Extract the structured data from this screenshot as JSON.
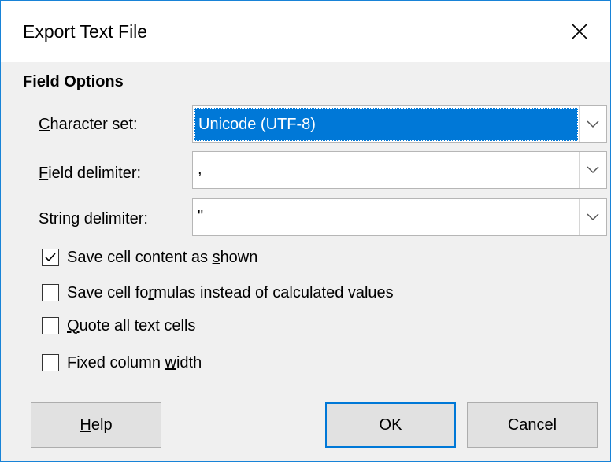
{
  "window": {
    "title": "Export Text File",
    "close_symbol": "✕"
  },
  "field_options": {
    "title": "Field Options",
    "character_set": {
      "label_accel": "C",
      "label_rest": "haracter set:",
      "value": "Unicode (UTF-8)"
    },
    "field_delimiter": {
      "label_accel": "F",
      "label_rest": "ield delimiter:",
      "value": ","
    },
    "string_delimiter": {
      "label": "String delimiter:",
      "value": "\""
    }
  },
  "checkboxes": [
    {
      "pre": "Save cell content as ",
      "accel": "s",
      "post": "hown",
      "checked": true
    },
    {
      "pre": "Save cell fo",
      "accel": "r",
      "post": "mulas instead of calculated values",
      "checked": false
    },
    {
      "pre": "",
      "accel": "Q",
      "post": "uote all text cells",
      "checked": false
    },
    {
      "pre": "Fixed column ",
      "accel": "w",
      "post": "idth",
      "checked": false
    }
  ],
  "buttons": {
    "help_accel": "H",
    "help_rest": "elp",
    "ok": "OK",
    "cancel": "Cancel"
  },
  "colors": {
    "accent": "#0078d7",
    "window_border": "#1883d7",
    "dialog_bg": "#f0f0f0"
  },
  "icons": {
    "close": "close-icon",
    "dropdown": "chevron-down-icon",
    "check": "checkmark-icon"
  }
}
